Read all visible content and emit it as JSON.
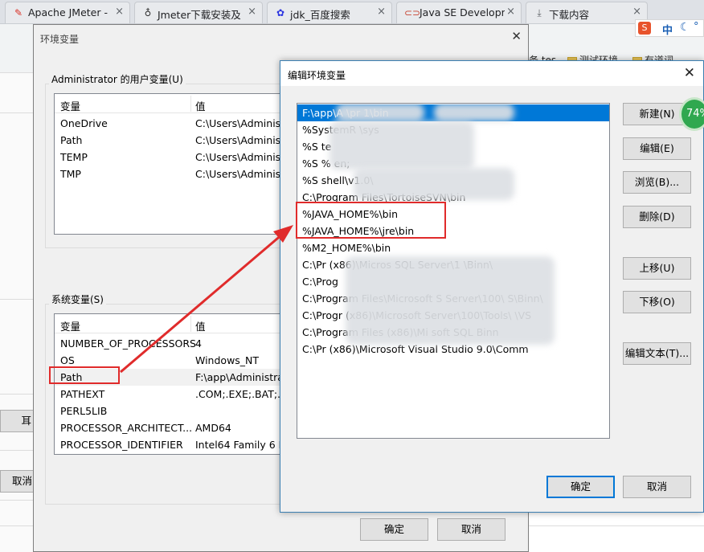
{
  "browser": {
    "tabs": [
      {
        "icon": "pen-icon",
        "label": "Apache JMeter - ",
        "color": "#d93025"
      },
      {
        "icon": "github-icon",
        "label": "Jmeter下载安装及",
        "color": "#333333"
      },
      {
        "icon": "baidu-paw-icon",
        "label": "jdk_百度搜索",
        "color": "#2932e1"
      },
      {
        "icon": "oracle-icon",
        "label": "Java SE Developm",
        "color": "#c74634"
      },
      {
        "icon": "download-icon",
        "label": "下载内容",
        "color": "#5f6368"
      }
    ],
    "ime_label": "中",
    "bookmarks": [
      "测试环境",
      "有道词"
    ],
    "bookmark_fragment": "务 tes",
    "left_button_fragment": "耳",
    "cancel_fragment": "取消",
    "battery_badge": "74%"
  },
  "env_dialog": {
    "title": "环境变量",
    "user_group_title": "Administrator 的用户变量(U)",
    "col_variable": "变量",
    "col_value": "值",
    "user_vars": [
      {
        "name": "OneDrive",
        "value": "C:\\Users\\Administ"
      },
      {
        "name": "Path",
        "value": "C:\\Users\\Administ"
      },
      {
        "name": "TEMP",
        "value": "C:\\Users\\Administ"
      },
      {
        "name": "TMP",
        "value": "C:\\Users\\Administ"
      }
    ],
    "system_group_title": "系统变量(S)",
    "system_vars": [
      {
        "name": "NUMBER_OF_PROCESSORS",
        "value": "4"
      },
      {
        "name": "OS",
        "value": "Windows_NT"
      },
      {
        "name": "Path",
        "value": "F:\\app\\Administrat"
      },
      {
        "name": "PATHEXT",
        "value": ".COM;.EXE;.BAT;.C"
      },
      {
        "name": "PERL5LIB",
        "value": ""
      },
      {
        "name": "PROCESSOR_ARCHITECT...",
        "value": "AMD64"
      },
      {
        "name": "PROCESSOR_IDENTIFIER",
        "value": "Intel64 Family 6 M"
      }
    ],
    "ok_label": "确定",
    "cancel_label": "取消"
  },
  "edit_dialog": {
    "title": "编辑环境变量",
    "paths": [
      "F:\\app\\A                  \\pr                    1\\bin",
      "%SystemR              \\sys",
      "%S         te",
      "%S          %             en;",
      "%S                               shell\\v1.0\\",
      "C:\\Program Files\\TortoiseSVN\\bin",
      "%JAVA_HOME%\\bin",
      "%JAVA_HOME%\\jre\\bin",
      "%M2_HOME%\\bin",
      "C:\\Pr              (x86)\\Micros       SQL Server\\1       \\Binn\\",
      "C:\\Prog",
      "C:\\Program Files\\Microsoft S  Server\\100\\  S\\Binn\\",
      "C:\\Progr         (x86)\\Microsoft    Server\\100\\Tools\\  \\VS",
      "C:\\Program Files (x86)\\Mi     soft SQL          Binn",
      "C:\\Pr           (x86)\\Microsoft Visual Studio 9.0\\Comm   "
    ],
    "buttons": {
      "new": "新建(N)",
      "edit": "编辑(E)",
      "browse": "浏览(B)...",
      "delete": "删除(D)",
      "move_up": "上移(U)",
      "move_down": "下移(O)",
      "edit_text": "编辑文本(T)..."
    },
    "ok_label": "确定",
    "cancel_label": "取消"
  },
  "colors": {
    "selection": "#0078d7",
    "annotation": "#e02b2b",
    "badge": "#2fa84f"
  }
}
